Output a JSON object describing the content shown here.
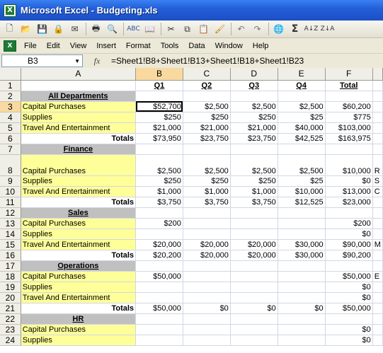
{
  "window": {
    "title": "Microsoft Excel - Budgeting.xls"
  },
  "toolbar": {
    "icons": [
      "new-icon",
      "open-icon",
      "save-icon",
      "permission-icon",
      "email-icon",
      "print-icon",
      "print-preview-icon",
      "spelling-icon",
      "research-icon",
      "cut-icon",
      "copy-icon",
      "paste-icon",
      "format-painter-icon",
      "undo-icon",
      "redo-icon",
      "hyperlink-icon",
      "autosum-icon",
      "sort-ascending-icon",
      "sort-descending-icon"
    ]
  },
  "menu": {
    "items": [
      "File",
      "Edit",
      "View",
      "Insert",
      "Format",
      "Tools",
      "Data",
      "Window",
      "Help"
    ]
  },
  "formula_bar": {
    "name_box": "B3",
    "fx": "fx",
    "formula": "=Sheet1!B8+Sheet1!B13+Sheet1!B18+Sheet1!B23"
  },
  "columns": [
    "A",
    "B",
    "C",
    "D",
    "E",
    "F"
  ],
  "rows": [
    {
      "n": "1",
      "a": "",
      "b": "Q1",
      "c": "Q2",
      "d": "Q3",
      "e": "Q4",
      "f": "Total",
      "type": "header"
    },
    {
      "n": "2",
      "a": "All Departments",
      "b": "",
      "c": "",
      "d": "",
      "e": "",
      "f": "",
      "type": "section"
    },
    {
      "n": "3",
      "a": "Capital Purchases",
      "b": "$52,700",
      "c": "$2,500",
      "d": "$2,500",
      "e": "$2,500",
      "f": "$60,200",
      "type": "item"
    },
    {
      "n": "4",
      "a": "Supplies",
      "b": "$250",
      "c": "$250",
      "d": "$250",
      "e": "$25",
      "f": "$775",
      "type": "item"
    },
    {
      "n": "5",
      "a": "Travel And Entertainment",
      "b": "$21,000",
      "c": "$21,000",
      "d": "$21,000",
      "e": "$40,000",
      "f": "$103,000",
      "type": "item"
    },
    {
      "n": "6",
      "a": "Totals",
      "b": "$73,950",
      "c": "$23,750",
      "d": "$23,750",
      "e": "$42,525",
      "f": "$163,975",
      "type": "total"
    },
    {
      "n": "7",
      "a": "Finance",
      "b": "",
      "c": "",
      "d": "",
      "e": "",
      "f": "",
      "type": "section"
    },
    {
      "n": "8",
      "a": "Capital Purchases",
      "b": "$2,500",
      "c": "$2,500",
      "d": "$2,500",
      "e": "$2,500",
      "f": "$10,000",
      "g": "R",
      "type": "item",
      "tall": true
    },
    {
      "n": "9",
      "a": "Supplies",
      "b": "$250",
      "c": "$250",
      "d": "$250",
      "e": "$25",
      "f": "$0",
      "g": "S",
      "type": "item"
    },
    {
      "n": "10",
      "a": "Travel And Entertainment",
      "b": "$1,000",
      "c": "$1,000",
      "d": "$1,000",
      "e": "$10,000",
      "f": "$13,000",
      "g": "C",
      "type": "item"
    },
    {
      "n": "11",
      "a": "Totals",
      "b": "$3,750",
      "c": "$3,750",
      "d": "$3,750",
      "e": "$12,525",
      "f": "$23,000",
      "type": "total"
    },
    {
      "n": "12",
      "a": "Sales",
      "b": "",
      "c": "",
      "d": "",
      "e": "",
      "f": "",
      "type": "section"
    },
    {
      "n": "13",
      "a": "Capital Purchases",
      "b": "$200",
      "c": "",
      "d": "",
      "e": "",
      "f": "$200",
      "type": "item"
    },
    {
      "n": "14",
      "a": "Supplies",
      "b": "",
      "c": "",
      "d": "",
      "e": "",
      "f": "$0",
      "type": "item"
    },
    {
      "n": "15",
      "a": "Travel And Entertainment",
      "b": "$20,000",
      "c": "$20,000",
      "d": "$20,000",
      "e": "$30,000",
      "f": "$90,000",
      "g": "M",
      "type": "item"
    },
    {
      "n": "16",
      "a": "Totals",
      "b": "$20,200",
      "c": "$20,000",
      "d": "$20,000",
      "e": "$30,000",
      "f": "$90,200",
      "type": "total"
    },
    {
      "n": "17",
      "a": "Operations",
      "b": "",
      "c": "",
      "d": "",
      "e": "",
      "f": "",
      "type": "section"
    },
    {
      "n": "18",
      "a": "Capital Purchases",
      "b": "$50,000",
      "c": "",
      "d": "",
      "e": "",
      "f": "$50,000",
      "g": "E",
      "type": "item"
    },
    {
      "n": "19",
      "a": "Supplies",
      "b": "",
      "c": "",
      "d": "",
      "e": "",
      "f": "$0",
      "type": "item"
    },
    {
      "n": "20",
      "a": "Travel And Entertainment",
      "b": "",
      "c": "",
      "d": "",
      "e": "",
      "f": "$0",
      "type": "item"
    },
    {
      "n": "21",
      "a": "Totals",
      "b": "$50,000",
      "c": "$0",
      "d": "$0",
      "e": "$0",
      "f": "$50,000",
      "type": "total"
    },
    {
      "n": "22",
      "a": "HR",
      "b": "",
      "c": "",
      "d": "",
      "e": "",
      "f": "",
      "type": "section"
    },
    {
      "n": "23",
      "a": "Capital Purchases",
      "b": "",
      "c": "",
      "d": "",
      "e": "",
      "f": "$0",
      "type": "item"
    },
    {
      "n": "24",
      "a": "Supplies",
      "b": "",
      "c": "",
      "d": "",
      "e": "",
      "f": "$0",
      "type": "item"
    }
  ]
}
